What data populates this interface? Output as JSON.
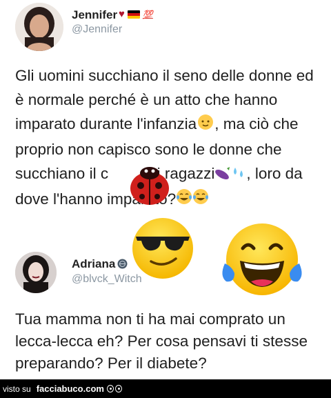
{
  "tweet1": {
    "author_name": "Jennifer",
    "author_badges": [
      "heart-emoji",
      "flag-emoji",
      "hundred-points-emoji"
    ],
    "handle": "@Jennifer",
    "text_part1": "Gli uomini succhiano il seno delle donne ed è normale perché è un atto che hanno imparato durante l'infanzia",
    "text_part2": ", ma ciò che proprio non capisco sono le donne che succhiano il c",
    "text_part3": "ai ragazzi",
    "text_part4": ", loro da dove l'hanno imparato?"
  },
  "tweet2": {
    "author_name": "Adriana",
    "handle": "@blvck_Witch",
    "text": "Tua mamma non ti ha mai comprato un lecca-lecca eh? Per cosa pensavi ti stesse preparando? Per il diabete?"
  },
  "footer": {
    "prefix": "visto su",
    "site": "facciabuco.com"
  },
  "colors": {
    "handle": "#8b97a2",
    "footer_bg": "#000000",
    "emoji_yellow": "#ffd21f",
    "ladybug_red": "#d0201c"
  }
}
